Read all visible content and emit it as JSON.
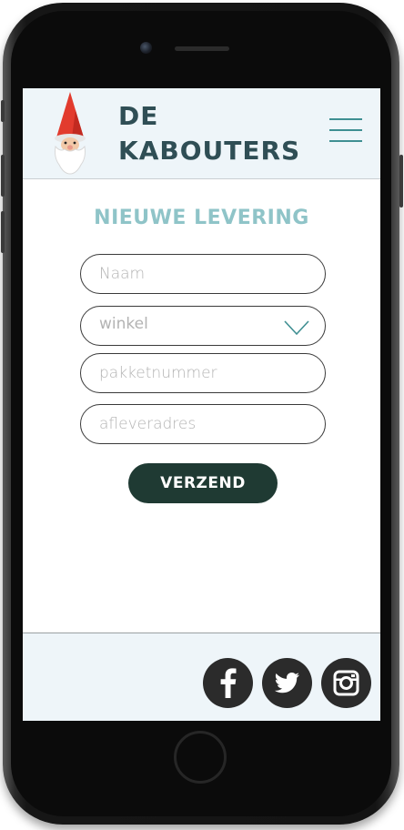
{
  "header": {
    "brand_line1": "DE",
    "brand_line2": "KABOUTERS",
    "logo_icon": "gnome-icon",
    "menu_icon": "hamburger-menu-icon"
  },
  "form": {
    "title": "NIEUWE LEVERING",
    "name_placeholder": "Naam",
    "store_value": "winkel",
    "store_icon": "chevron-down-icon",
    "package_placeholder": "pakketnummer",
    "address_placeholder": "afleveradres",
    "submit_label": "VERZEND"
  },
  "footer": {
    "social": [
      "facebook-icon",
      "twitter-icon",
      "instagram-icon"
    ]
  },
  "colors": {
    "header_bg": "#eef5f9",
    "brand_text": "#2f4e55",
    "title_text": "#8fc4c8",
    "accent": "#3f8f92",
    "button_bg": "#1f3a33",
    "social_bg": "#2b2b2b"
  }
}
